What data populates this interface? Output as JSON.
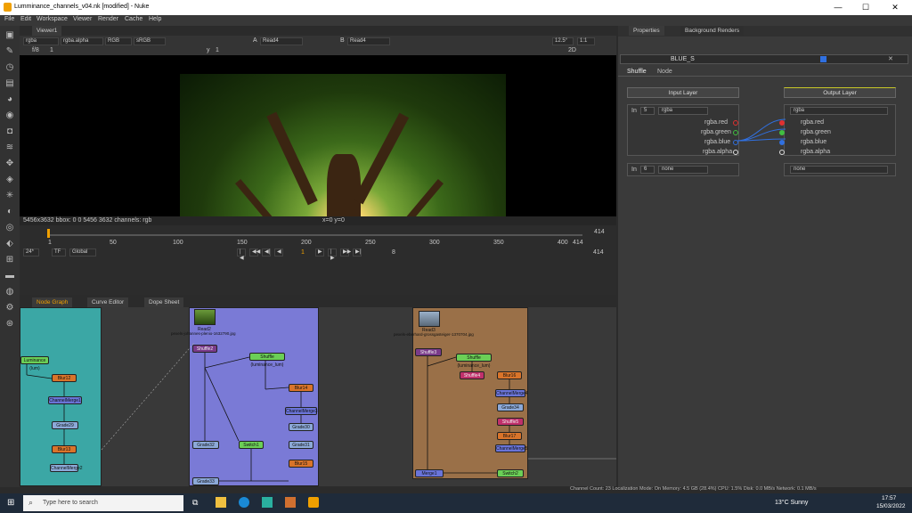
{
  "window": {
    "title": "Lumminance_channels_v04.nk [modified] - Nuke",
    "minimize": "—",
    "maximize": "☐",
    "close": "✕"
  },
  "menu": [
    "File",
    "Edit",
    "Workspace",
    "Viewer",
    "Render",
    "Cache",
    "Help"
  ],
  "viewer": {
    "tab": "Viewer1",
    "channels": "rgba",
    "alpha": "rgba.alpha",
    "display": "RGB",
    "colorspace": "sRGB",
    "input_a_label": "A",
    "input_a": "Read4",
    "input_b_label": "B",
    "input_b": "Read4",
    "zoom": "12.5°",
    "ratio": "1:1",
    "frame": "f/8",
    "one": "1",
    "y_label": "y",
    "y": "1",
    "mode2d": "2D",
    "info": "5456x3632  bbox: 0 0 5456 3632 channels: rgb",
    "coords": "x=0 y=0"
  },
  "timeline": {
    "ticks": [
      "1",
      "50",
      "100",
      "150",
      "200",
      "250",
      "300",
      "350",
      "400",
      "414"
    ],
    "end": "414",
    "current": "1",
    "fps": "24*",
    "tf": "TF",
    "scope": "Global",
    "step": "8",
    "end2": "414"
  },
  "bottom_tabs": [
    "Node Graph",
    "Curve Editor",
    "Dope Sheet"
  ],
  "node_graph": {
    "read2": {
      "name": "Read2",
      "file": "pexels-johannes-plenio-1632790.jpg",
      "info": "fr: range (1 - 1)"
    },
    "read_b": {
      "name": "Read3",
      "file": "pexels-eberhard-grossgasteiger-1370704.jpg",
      "info": "fr: range (1 - 1)"
    },
    "nodes": {
      "luma1": "Luminance (lum)",
      "blur12": "Blur12",
      "cm1": "ChannelMerge1",
      "grade29": "Grade29",
      "blur13": "Blur13",
      "cm2": "ChannelMerge2",
      "shuffle2": "Shuffle2",
      "lum2": "Shuffle (luminance_lum)",
      "blur14": "Blur14",
      "cm3": "ChannelMerge3",
      "grade30": "Grade30",
      "blur15": "Blur15",
      "grade31": "Grade31",
      "grade32": "Grade32",
      "rb2": "Switch1",
      "grade33": "Grade33",
      "shuffle3": "Shuffle3",
      "lum3": "Shuffle (luminance_lum)",
      "shuffle4": "Shuffle4",
      "blur16": "Blur16",
      "cm4": "ChannelMerge4",
      "grade34": "Grade34",
      "shuffle5": "Shuffle5",
      "blur17": "Blur17",
      "cm5": "ChannelMerge5",
      "merge": "Merge1",
      "switch2": "Switch2"
    }
  },
  "properties": {
    "tab": "Properties",
    "tab2": "Background Renders",
    "node_name": "BLUE_S",
    "subtabs": [
      "Shuffle",
      "Node"
    ],
    "input_layer": "Input Layer",
    "output_layer": "Output Layer",
    "in_label": "In",
    "in_num": "5",
    "in_layer": "rgba",
    "out_layer": "rgba",
    "in2_num": "6",
    "in2_layer": "none",
    "out2_layer": "none",
    "in_channels": [
      "rgba.red",
      "rgba.green",
      "rgba.blue",
      "rgba.alpha"
    ],
    "out_channels": [
      "rgba.red",
      "rgba.green",
      "rgba.blue",
      "rgba.alpha"
    ],
    "colors": {
      "red": "#e03030",
      "green": "#40c040",
      "blue": "#3070e0",
      "alpha": "#dddddd"
    }
  },
  "status": "Channel Count: 23  Localization Mode: On  Memory: 4.5 GB (28.4%)  CPU: 1.5%  Disk: 0.0 MB/s  Network: 0.1 MB/s",
  "taskbar": {
    "search": "Type here to search",
    "weather": "13°C  Sunny",
    "time": "17:57",
    "date": "15/03/2022"
  }
}
